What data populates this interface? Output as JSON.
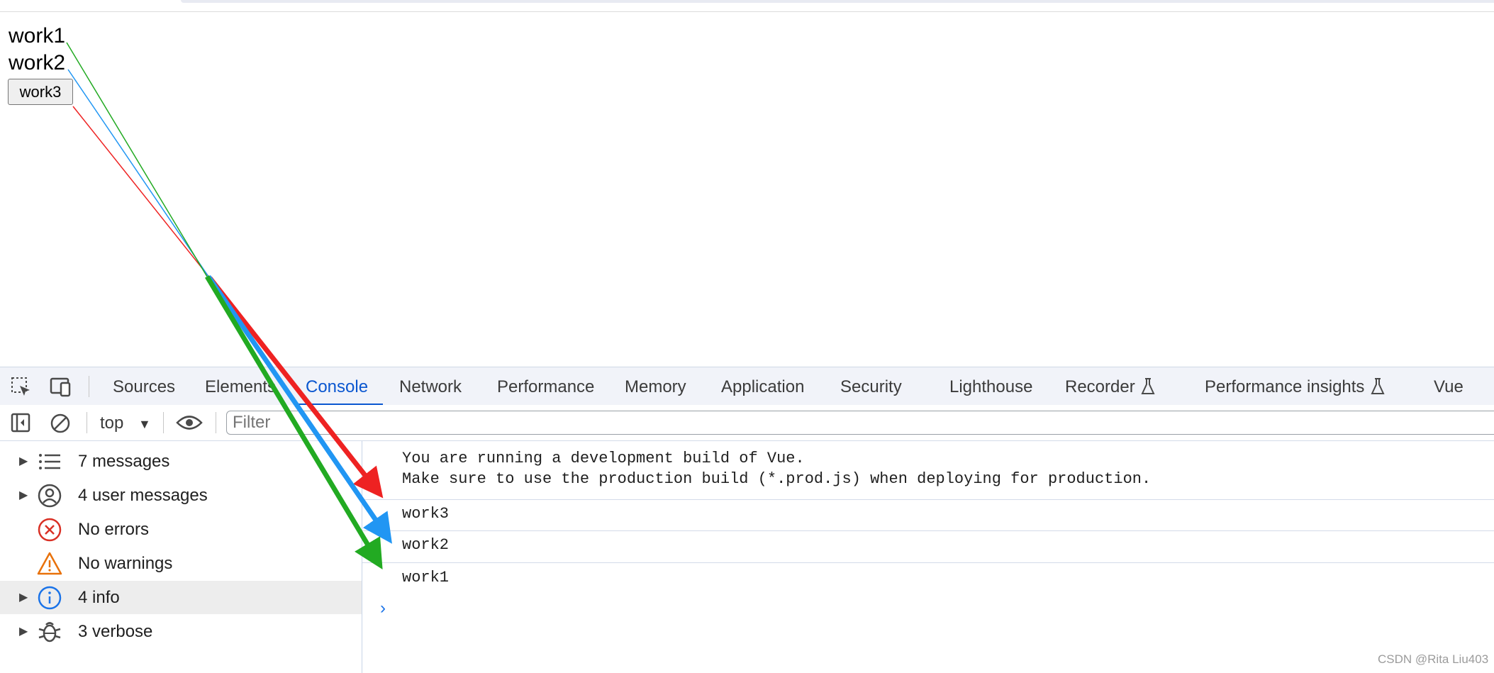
{
  "page": {
    "text1": "work1",
    "text2": "work2",
    "button": "work3"
  },
  "devtools": {
    "tabs": [
      "Sources",
      "Elements",
      "Console",
      "Network",
      "Performance",
      "Memory",
      "Application",
      "Security",
      "Lighthouse",
      "Recorder",
      "Performance insights",
      "Vue"
    ],
    "active_tab": "Console",
    "context": "top",
    "filter_placeholder": "Filter",
    "sidebar": [
      {
        "label": "7 messages",
        "icon": "list-icon",
        "expandable": true
      },
      {
        "label": "4 user messages",
        "icon": "user-icon",
        "expandable": true
      },
      {
        "label": "No errors",
        "icon": "error-icon",
        "expandable": false
      },
      {
        "label": "No warnings",
        "icon": "warning-icon",
        "expandable": false
      },
      {
        "label": "4 info",
        "icon": "info-icon",
        "expandable": true,
        "selected": true
      },
      {
        "label": "3 verbose",
        "icon": "bug-icon",
        "expandable": true
      }
    ],
    "console": {
      "vue_notice_line1": "You are running a development build of Vue.",
      "vue_notice_line2": "Make sure to use the production build (*.prod.js) when deploying for production.",
      "logs": [
        "work3",
        "work2",
        "work1"
      ]
    }
  },
  "annotation_arrows": [
    {
      "from": "work1",
      "to": "work1",
      "color": "#22aa22"
    },
    {
      "from": "work2",
      "to": "work2",
      "color": "#2196f3"
    },
    {
      "from": "work3",
      "to": "work3",
      "color": "#ee2222"
    }
  ],
  "watermark": "CSDN @Rita Liu403",
  "colors": {
    "accent": "#0b57d0",
    "error": "#d93025",
    "warning": "#e8710a",
    "info": "#1a73e8"
  }
}
